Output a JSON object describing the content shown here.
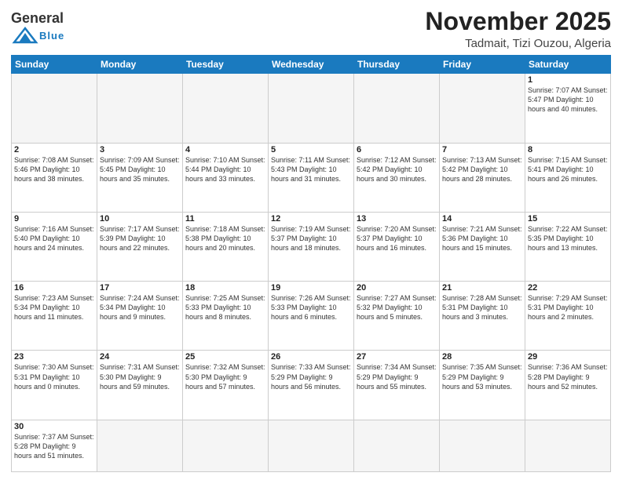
{
  "header": {
    "logo_general": "General",
    "logo_blue": "Blue",
    "month_title": "November 2025",
    "location": "Tadmait, Tizi Ouzou, Algeria"
  },
  "days_of_week": [
    "Sunday",
    "Monday",
    "Tuesday",
    "Wednesday",
    "Thursday",
    "Friday",
    "Saturday"
  ],
  "weeks": [
    [
      {
        "day": "",
        "info": ""
      },
      {
        "day": "",
        "info": ""
      },
      {
        "day": "",
        "info": ""
      },
      {
        "day": "",
        "info": ""
      },
      {
        "day": "",
        "info": ""
      },
      {
        "day": "",
        "info": ""
      },
      {
        "day": "1",
        "info": "Sunrise: 7:07 AM\nSunset: 5:47 PM\nDaylight: 10 hours and 40 minutes."
      }
    ],
    [
      {
        "day": "2",
        "info": "Sunrise: 7:08 AM\nSunset: 5:46 PM\nDaylight: 10 hours and 38 minutes."
      },
      {
        "day": "3",
        "info": "Sunrise: 7:09 AM\nSunset: 5:45 PM\nDaylight: 10 hours and 35 minutes."
      },
      {
        "day": "4",
        "info": "Sunrise: 7:10 AM\nSunset: 5:44 PM\nDaylight: 10 hours and 33 minutes."
      },
      {
        "day": "5",
        "info": "Sunrise: 7:11 AM\nSunset: 5:43 PM\nDaylight: 10 hours and 31 minutes."
      },
      {
        "day": "6",
        "info": "Sunrise: 7:12 AM\nSunset: 5:42 PM\nDaylight: 10 hours and 30 minutes."
      },
      {
        "day": "7",
        "info": "Sunrise: 7:13 AM\nSunset: 5:42 PM\nDaylight: 10 hours and 28 minutes."
      },
      {
        "day": "8",
        "info": "Sunrise: 7:15 AM\nSunset: 5:41 PM\nDaylight: 10 hours and 26 minutes."
      }
    ],
    [
      {
        "day": "9",
        "info": "Sunrise: 7:16 AM\nSunset: 5:40 PM\nDaylight: 10 hours and 24 minutes."
      },
      {
        "day": "10",
        "info": "Sunrise: 7:17 AM\nSunset: 5:39 PM\nDaylight: 10 hours and 22 minutes."
      },
      {
        "day": "11",
        "info": "Sunrise: 7:18 AM\nSunset: 5:38 PM\nDaylight: 10 hours and 20 minutes."
      },
      {
        "day": "12",
        "info": "Sunrise: 7:19 AM\nSunset: 5:37 PM\nDaylight: 10 hours and 18 minutes."
      },
      {
        "day": "13",
        "info": "Sunrise: 7:20 AM\nSunset: 5:37 PM\nDaylight: 10 hours and 16 minutes."
      },
      {
        "day": "14",
        "info": "Sunrise: 7:21 AM\nSunset: 5:36 PM\nDaylight: 10 hours and 15 minutes."
      },
      {
        "day": "15",
        "info": "Sunrise: 7:22 AM\nSunset: 5:35 PM\nDaylight: 10 hours and 13 minutes."
      }
    ],
    [
      {
        "day": "16",
        "info": "Sunrise: 7:23 AM\nSunset: 5:34 PM\nDaylight: 10 hours and 11 minutes."
      },
      {
        "day": "17",
        "info": "Sunrise: 7:24 AM\nSunset: 5:34 PM\nDaylight: 10 hours and 9 minutes."
      },
      {
        "day": "18",
        "info": "Sunrise: 7:25 AM\nSunset: 5:33 PM\nDaylight: 10 hours and 8 minutes."
      },
      {
        "day": "19",
        "info": "Sunrise: 7:26 AM\nSunset: 5:33 PM\nDaylight: 10 hours and 6 minutes."
      },
      {
        "day": "20",
        "info": "Sunrise: 7:27 AM\nSunset: 5:32 PM\nDaylight: 10 hours and 5 minutes."
      },
      {
        "day": "21",
        "info": "Sunrise: 7:28 AM\nSunset: 5:31 PM\nDaylight: 10 hours and 3 minutes."
      },
      {
        "day": "22",
        "info": "Sunrise: 7:29 AM\nSunset: 5:31 PM\nDaylight: 10 hours and 2 minutes."
      }
    ],
    [
      {
        "day": "23",
        "info": "Sunrise: 7:30 AM\nSunset: 5:31 PM\nDaylight: 10 hours and 0 minutes."
      },
      {
        "day": "24",
        "info": "Sunrise: 7:31 AM\nSunset: 5:30 PM\nDaylight: 9 hours and 59 minutes."
      },
      {
        "day": "25",
        "info": "Sunrise: 7:32 AM\nSunset: 5:30 PM\nDaylight: 9 hours and 57 minutes."
      },
      {
        "day": "26",
        "info": "Sunrise: 7:33 AM\nSunset: 5:29 PM\nDaylight: 9 hours and 56 minutes."
      },
      {
        "day": "27",
        "info": "Sunrise: 7:34 AM\nSunset: 5:29 PM\nDaylight: 9 hours and 55 minutes."
      },
      {
        "day": "28",
        "info": "Sunrise: 7:35 AM\nSunset: 5:29 PM\nDaylight: 9 hours and 53 minutes."
      },
      {
        "day": "29",
        "info": "Sunrise: 7:36 AM\nSunset: 5:28 PM\nDaylight: 9 hours and 52 minutes."
      }
    ],
    [
      {
        "day": "30",
        "info": "Sunrise: 7:37 AM\nSunset: 5:28 PM\nDaylight: 9 hours and 51 minutes."
      },
      {
        "day": "",
        "info": ""
      },
      {
        "day": "",
        "info": ""
      },
      {
        "day": "",
        "info": ""
      },
      {
        "day": "",
        "info": ""
      },
      {
        "day": "",
        "info": ""
      },
      {
        "day": "",
        "info": ""
      }
    ]
  ]
}
